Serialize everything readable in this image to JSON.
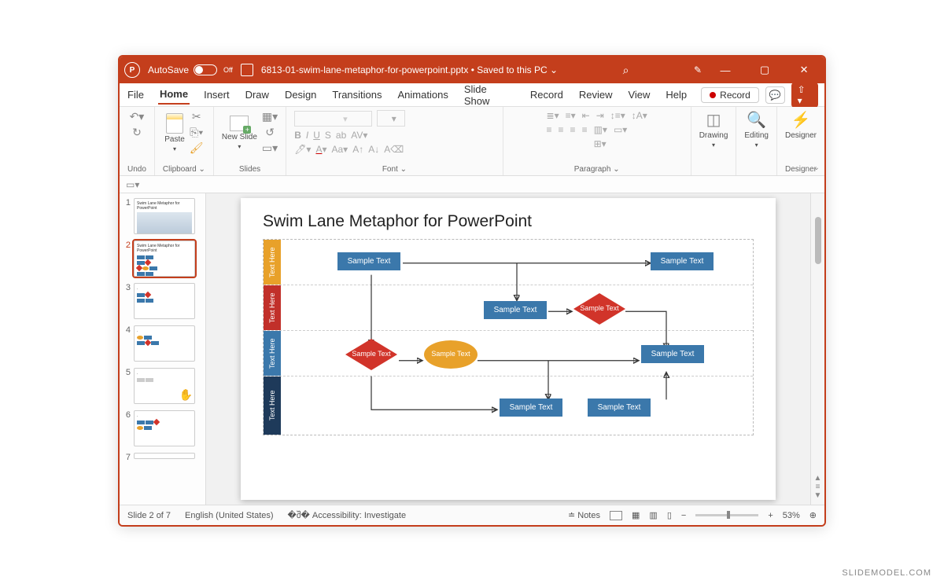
{
  "watermark": "SLIDEMODEL.COM",
  "titlebar": {
    "autosave_label": "AutoSave",
    "autosave_state": "Off",
    "filename": "6813-01-swim-lane-metaphor-for-powerpoint.pptx",
    "saved_state": "Saved to this PC"
  },
  "menu": {
    "file": "File",
    "home": "Home",
    "insert": "Insert",
    "draw": "Draw",
    "design": "Design",
    "transitions": "Transitions",
    "animations": "Animations",
    "slideshow": "Slide Show",
    "record": "Record",
    "review": "Review",
    "view": "View",
    "help": "Help",
    "record_btn": "Record"
  },
  "ribbon": {
    "undo": "Undo",
    "paste": "Paste",
    "clipboard": "Clipboard",
    "new_slide": "New Slide",
    "slides": "Slides",
    "font": "Font",
    "paragraph": "Paragraph",
    "drawing": "Drawing",
    "editing": "Editing",
    "designer": "Designer",
    "designer_grp": "Designer"
  },
  "thumbs": {
    "n1": "1",
    "n2": "2",
    "n3": "3",
    "n4": "4",
    "n5": "5",
    "n6": "6",
    "n7": "7"
  },
  "slide": {
    "title": "Swim Lane Metaphor for PowerPoint",
    "lane_label": "Text Here",
    "sample": "Sample Text",
    "sample_ml": "Sample\nText"
  },
  "status": {
    "slide_of": "Slide 2 of 7",
    "lang": "English (United States)",
    "access": "Accessibility: Investigate",
    "notes": "Notes",
    "zoom": "53%"
  }
}
